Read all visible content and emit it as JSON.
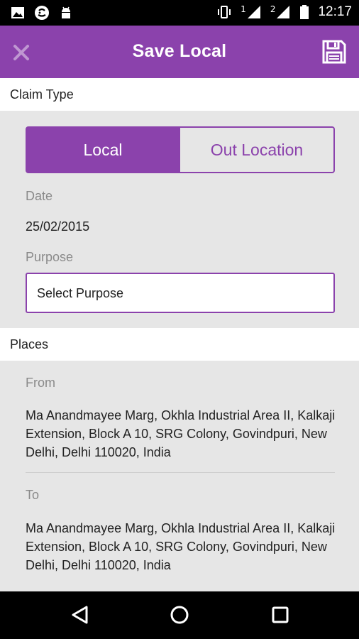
{
  "status_bar": {
    "time": "12:17",
    "signal_1_label": "1",
    "signal_2_label": "2",
    "icons": [
      "image-icon",
      "chat-icon",
      "android-icon",
      "vibrate-icon",
      "signal-icon",
      "signal-icon",
      "battery-icon"
    ]
  },
  "app_bar": {
    "title": "Save Local",
    "close_icon": "close-icon",
    "save_icon": "floppy-disk-icon",
    "color": "#8b42ac"
  },
  "claim_type": {
    "header": "Claim Type",
    "options": [
      "Local",
      "Out Location"
    ],
    "selected": "Local"
  },
  "date": {
    "label": "Date",
    "value": "25/02/2015"
  },
  "purpose": {
    "label": "Purpose",
    "value": "Select Purpose"
  },
  "places": {
    "header": "Places",
    "from_label": "From",
    "from_value": "Ma Anandmayee Marg, Okhla Industrial Area II, Kalkaji Extension, Block A 10, SRG Colony, Govindpuri, New Delhi, Delhi 110020, India",
    "to_label": "To",
    "to_value": "Ma Anandmayee Marg, Okhla Industrial Area II, Kalkaji Extension, Block A 10, SRG Colony, Govindpuri, New Delhi, Delhi 110020, India"
  },
  "nav_bar": {
    "icons": [
      "back-icon",
      "home-icon",
      "recents-icon"
    ]
  }
}
